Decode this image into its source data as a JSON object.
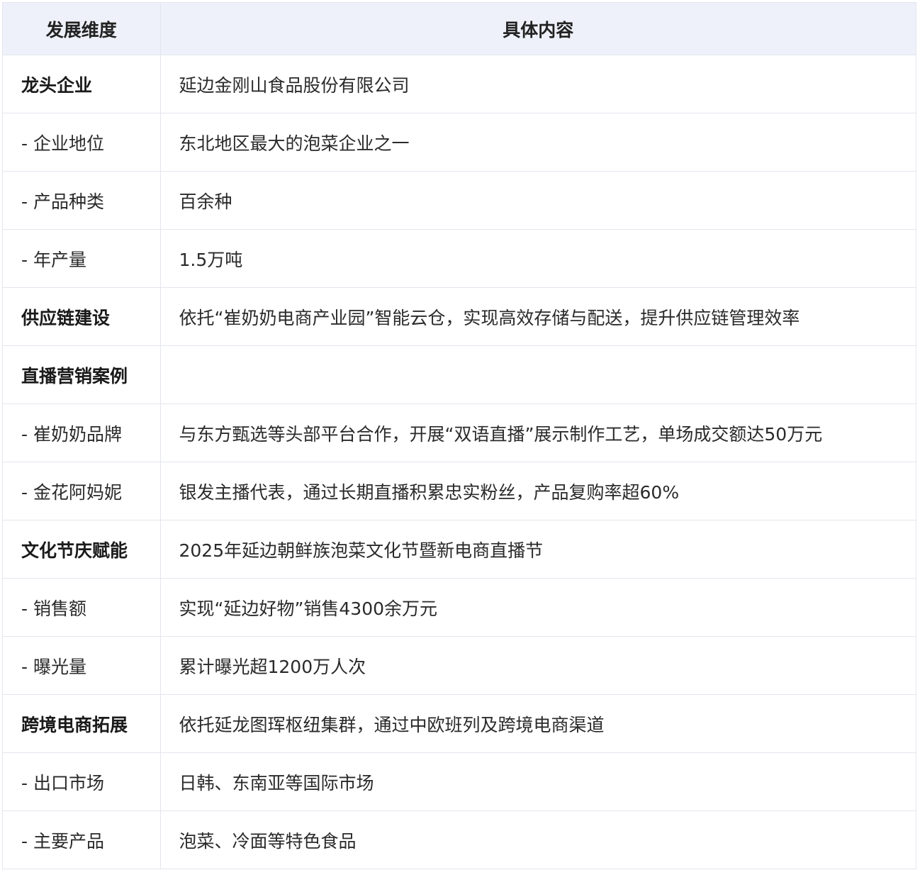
{
  "table": {
    "headers": [
      "发展维度",
      "具体内容"
    ],
    "rows": [
      {
        "dimension": "龙头企业",
        "content": "延边金刚山食品股份有限公司",
        "bold": true
      },
      {
        "dimension": "- 企业地位",
        "content": "东北地区最大的泡菜企业之一",
        "bold": false
      },
      {
        "dimension": "- 产品种类",
        "content": "百余种",
        "bold": false
      },
      {
        "dimension": "- 年产量",
        "content": "1.5万吨",
        "bold": false
      },
      {
        "dimension": "供应链建设",
        "content": "依托“崔奶奶电商产业园”智能云仓，实现高效存储与配送，提升供应链管理效率",
        "bold": true
      },
      {
        "dimension": "直播营销案例",
        "content": "",
        "bold": true
      },
      {
        "dimension": "- 崔奶奶品牌",
        "content": "与东方甄选等头部平台合作，开展“双语直播”展示制作工艺，单场成交额达50万元",
        "bold": false
      },
      {
        "dimension": "- 金花阿妈妮",
        "content": "银发主播代表，通过长期直播积累忠实粉丝，产品复购率超60%",
        "bold": false
      },
      {
        "dimension": "文化节庆赋能",
        "content": "2025年延边朝鲜族泡菜文化节暨新电商直播节",
        "bold": true
      },
      {
        "dimension": "- 销售额",
        "content": "实现“延边好物”销售4300余万元",
        "bold": false
      },
      {
        "dimension": "- 曝光量",
        "content": "累计曝光超1200万人次",
        "bold": false
      },
      {
        "dimension": "跨境电商拓展",
        "content": "依托延龙图珲枢纽集群，通过中欧班列及跨境电商渠道",
        "bold": true
      },
      {
        "dimension": "- 出口市场",
        "content": "日韩、东南亚等国际市场",
        "bold": false
      },
      {
        "dimension": "- 主要产品",
        "content": "泡菜、冷面等特色食品",
        "bold": false
      }
    ]
  },
  "colors": {
    "header_bg": "#eef1f9",
    "border": "#e3e6ee",
    "text": "#2a2a2a"
  }
}
